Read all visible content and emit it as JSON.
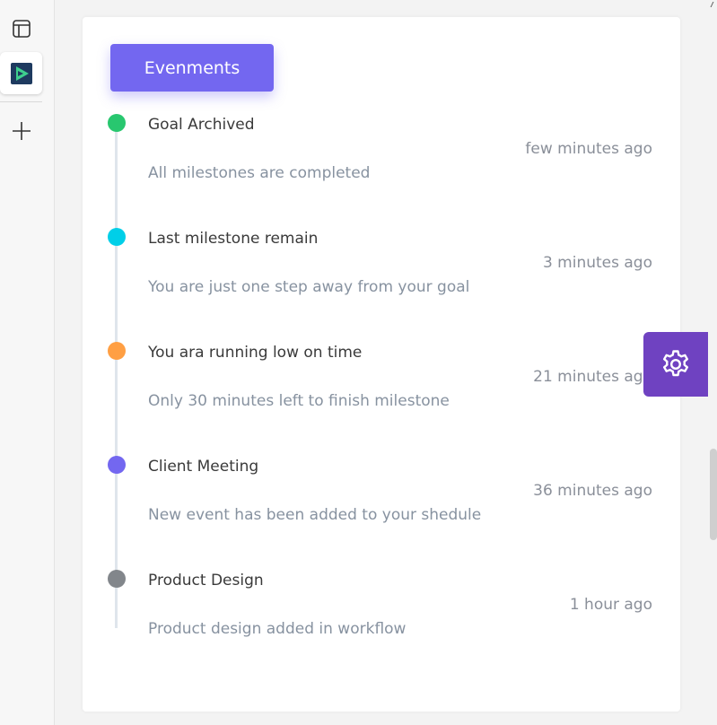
{
  "header": {
    "button_label": "Evenments"
  },
  "events": [
    {
      "title": "Goal Archived",
      "time": "few minutes ago",
      "description": "All milestones are completed",
      "dot_color": "#28c76f"
    },
    {
      "title": "Last milestone remain",
      "time": "3 minutes ago",
      "description": "You are just one step away from your goal",
      "dot_color": "#00cfe8"
    },
    {
      "title": "You ara running low on time",
      "time": "21 minutes ago",
      "description": "Only 30 minutes left to finish milestone",
      "dot_color": "#ff9f43"
    },
    {
      "title": "Client Meeting",
      "time": "36 minutes ago",
      "description": "New event has been added to your shedule",
      "dot_color": "#7367f0"
    },
    {
      "title": "Product Design",
      "time": "1 hour ago",
      "description": "Product design added in workflow",
      "dot_color": "#82868b"
    }
  ],
  "colors": {
    "accent": "#7367f0",
    "settings": "#6f42c1"
  },
  "icons": {
    "panel": "sidebar-panel-icon",
    "app": "app-logo-icon",
    "add": "plus-icon",
    "settings": "gear-icon"
  }
}
